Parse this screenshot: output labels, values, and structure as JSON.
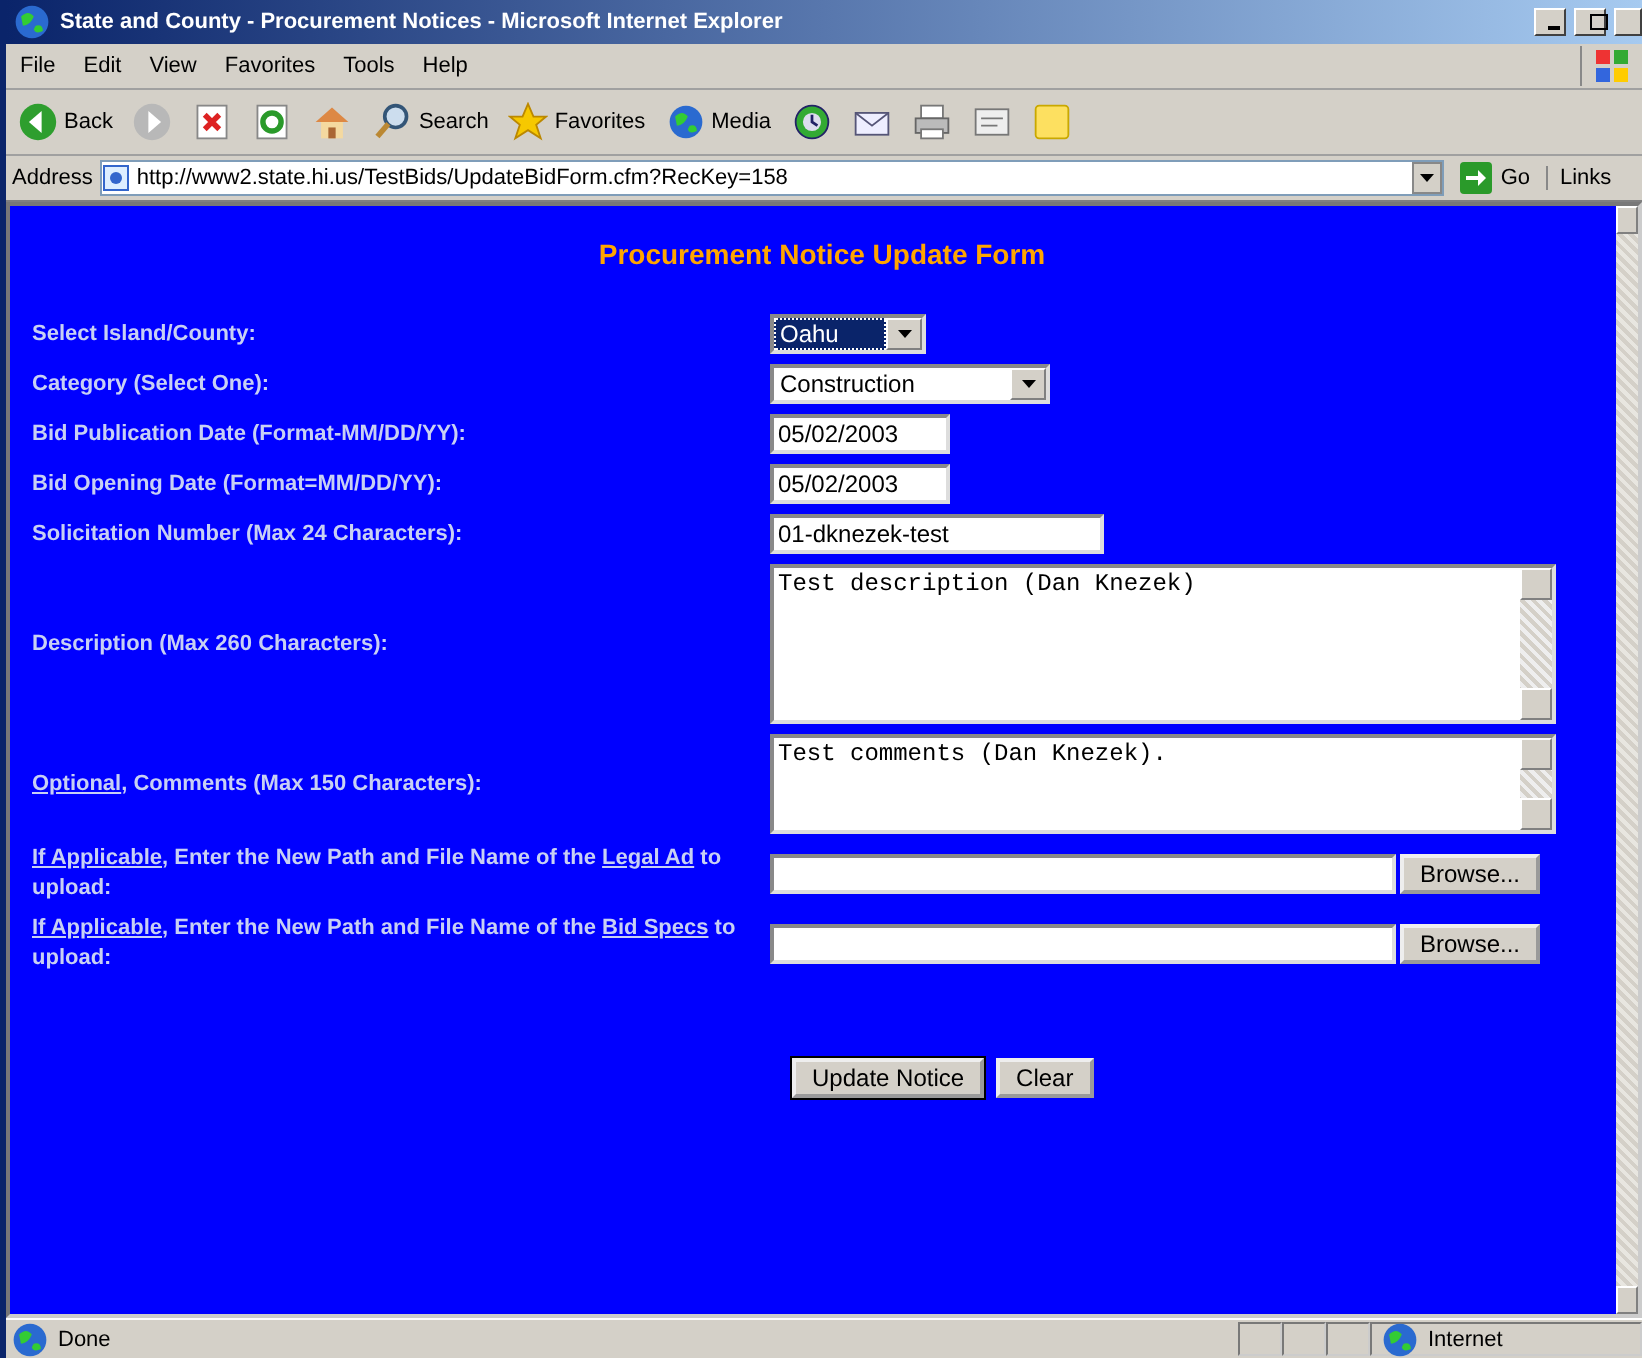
{
  "window": {
    "title": "State and County - Procurement Notices - Microsoft Internet Explorer"
  },
  "menu": [
    "File",
    "Edit",
    "View",
    "Favorites",
    "Tools",
    "Help"
  ],
  "toolbar": [
    {
      "kind": "back",
      "label": "Back"
    },
    {
      "kind": "forward"
    },
    {
      "kind": "stop"
    },
    {
      "kind": "refresh"
    },
    {
      "kind": "home"
    },
    {
      "kind": "search",
      "label": "Search"
    },
    {
      "kind": "favorites",
      "label": "Favorites"
    },
    {
      "kind": "media",
      "label": "Media"
    },
    {
      "kind": "history"
    },
    {
      "kind": "mail"
    },
    {
      "kind": "print"
    },
    {
      "kind": "edit"
    },
    {
      "kind": "note"
    }
  ],
  "address": {
    "label": "Address",
    "url": "http://www2.state.hi.us/TestBids/UpdateBidForm.cfm?RecKey=158",
    "go": "Go",
    "links": "Links"
  },
  "form": {
    "title": "Procurement Notice Update Form",
    "rows": [
      {
        "kind": "select",
        "label": [
          {
            "text": "Select Island/County:",
            "link": false
          }
        ],
        "value": "Oahu",
        "focused": true
      },
      {
        "kind": "select",
        "label": [
          {
            "text": "Category (Select One):",
            "link": false
          }
        ],
        "value": "Construction",
        "focused": false
      },
      {
        "kind": "text",
        "label": [
          {
            "text": "Bid Publication Date (Format-MM/DD/YY):",
            "link": false
          }
        ],
        "value": "05/02/2003"
      },
      {
        "kind": "text",
        "label": [
          {
            "text": "Bid Opening Date (Format=MM/DD/YY):",
            "link": false
          }
        ],
        "value": "05/02/2003"
      },
      {
        "kind": "text",
        "label": [
          {
            "text": "Solicitation Number (Max 24 Characters):",
            "link": false
          }
        ],
        "value": "01-dknezek-test"
      },
      {
        "kind": "textarea",
        "label": [
          {
            "text": "Description (Max 260 Characters):",
            "link": false
          }
        ],
        "value": "Test description (Dan Knezek)"
      },
      {
        "kind": "textarea",
        "label": [
          {
            "text": "Optional",
            "link": true
          },
          {
            "text": ", Comments (Max 150 Characters):",
            "link": false
          }
        ],
        "value": "Test comments (Dan Knezek)."
      },
      {
        "kind": "file",
        "label": [
          {
            "text": "If Applicable",
            "link": true
          },
          {
            "text": ", Enter the New Path and File Name of the ",
            "link": false
          },
          {
            "text": "Legal Ad",
            "link": true
          },
          {
            "text": " to upload:",
            "link": false
          }
        ],
        "button": "Browse..."
      },
      {
        "kind": "file",
        "label": [
          {
            "text": "If Applicable",
            "link": true
          },
          {
            "text": ", Enter the New Path and File Name of the ",
            "link": false
          },
          {
            "text": "Bid Specs",
            "link": true
          },
          {
            "text": " to upload:",
            "link": false
          }
        ],
        "button": "Browse..."
      }
    ],
    "buttons": [
      "Update Notice",
      "Clear"
    ]
  },
  "status_bar": {
    "text": "Done",
    "zone": "Internet"
  }
}
